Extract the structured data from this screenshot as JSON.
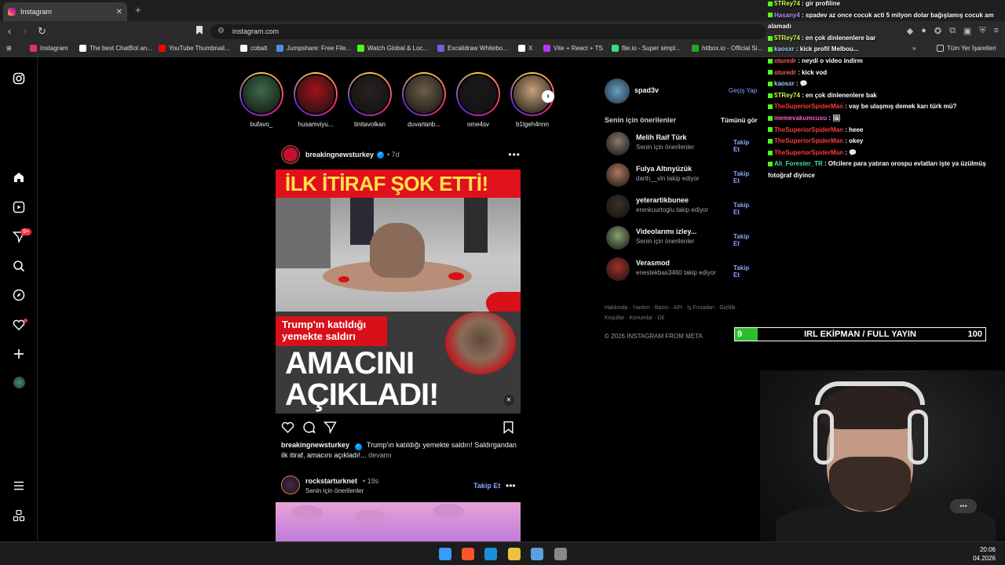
{
  "browser": {
    "tab_title": "Instagram",
    "tab_close": "✕",
    "new_tab": "+",
    "url": "instagram.com",
    "bookmarks": [
      {
        "label": "Instagram",
        "color": "#e1306c"
      },
      {
        "label": "The best ChatBot an...",
        "color": "#ffffff"
      },
      {
        "label": "YouTube Thumbnail...",
        "color": "#ff0000"
      },
      {
        "label": "cobalt",
        "color": "#ffffff"
      },
      {
        "label": "Jumpshare: Free File...",
        "color": "#4a90e2"
      },
      {
        "label": "Watch Global & Loc...",
        "color": "#53fc18"
      },
      {
        "label": "Excalidraw Whitebo...",
        "color": "#6965db"
      },
      {
        "label": "X",
        "color": "#ffffff"
      },
      {
        "label": "Vite + React + TS",
        "color": "#bd34fe"
      },
      {
        "label": "file.io - Super simpl...",
        "color": "#3ddc84"
      },
      {
        "label": "hitbox.io - Official Si...",
        "color": "#22aa22"
      }
    ],
    "all_bookmarks": "Tüm Yer İşaretleri"
  },
  "stories": [
    {
      "name": "bufavo_",
      "color": "#3d6b4a"
    },
    {
      "name": "husamviyu...",
      "color": "#a3121b"
    },
    {
      "name": "tinitavolkan",
      "color": "#2a2020"
    },
    {
      "name": "duvarlanb...",
      "color": "#6b5e4a"
    },
    {
      "name": "ome4sv",
      "color": "#1a1a1a"
    },
    {
      "name": "b1lgeh4nnn",
      "color": "#c9a27a"
    }
  ],
  "post": {
    "username": "breakingnewsturkey",
    "verified": "✓",
    "time": "• 7d",
    "more": "•••",
    "headline_top": "İLK İTİRAF ŞOK ETTİ!",
    "sub_headline": "Trump'ın katıldığı yemekte saldırı",
    "big_line1": "AMACINI",
    "big_line2": "AÇIKLADI!",
    "caption_user": "breakingnewsturkey",
    "caption_text": "Trump'ın katıldığı yemekte saldırı! Saldırgandan ilk itiraf, amacını açıkladı!...",
    "caption_more": "devamı"
  },
  "post2": {
    "username": "rockstarturknet",
    "time": "• 19s",
    "subtitle": "Senin için önerilenler",
    "follow": "Takip Et",
    "more": "•••"
  },
  "sidebar": {
    "me": "spad3v",
    "switch": "Geçiş Yap",
    "suggestions_title": "Senin için önerilenler",
    "see_all": "Tümünü gör",
    "follow_label": "Takip Et",
    "suggestions": [
      {
        "name": "Melih Raif Türk",
        "sub": "Senin için önerilenler",
        "color": "#8a7a6a"
      },
      {
        "name": "Fulya Altınyüzük",
        "sub": "darth__vin takip ediyor",
        "color": "#b07a60"
      },
      {
        "name": "yeterartikbunee",
        "sub": "erenkuurtoglu takip ediyor",
        "color": "#3a3028"
      },
      {
        "name": "Videolarımı izley...",
        "sub": "Senin için önerilenler",
        "color": "#8aa070"
      },
      {
        "name": "Verasmod",
        "sub": "enestekbas3460 takip ediyor",
        "color": "#a0302a"
      }
    ],
    "footer": "Hakkında · Yardım · Basın · API · İş Fırsatları · Gizlilik · Koşullar · Konumlar · Dil",
    "copyright": "© 2026 INSTAGRAM FROM META"
  },
  "chat": [
    {
      "user": "5TRey74",
      "color": "#c8ff4a",
      "text": "gir profiline"
    },
    {
      "user": "Hasany4",
      "color": "#b48cff",
      "text": "spadev az once cocuk acti 5 milyon dolar bağışlamış cocuk am"
    },
    {
      "user": "",
      "color": "#ffffff",
      "text": "alamadı"
    },
    {
      "user": "5TRey74",
      "color": "#c8ff4a",
      "text": "en çok dinlenenlere bar"
    },
    {
      "user": "kaosxr",
      "color": "#9ad0ff",
      "text": "kick profil Melbou..."
    },
    {
      "user": "oturedr",
      "color": "#ff5a5a",
      "text": "neydi o video indirm"
    },
    {
      "user": "oturedr",
      "color": "#ff5a5a",
      "text": "kick vod"
    },
    {
      "user": "kaosxr",
      "color": "#9ad0ff",
      "text": "💬"
    },
    {
      "user": "5TRey74",
      "color": "#c8ff4a",
      "text": "en çok dinlenenlere bak"
    },
    {
      "user": "TheSuperiorSpiderMan",
      "color": "#ff3b3b",
      "text": "vay be ulaşmış demek karı türk mü?"
    },
    {
      "user": "memevakumcusu",
      "color": "#ff5ac8",
      "text": "🖼"
    },
    {
      "user": "TheSuperiorSpiderMan",
      "color": "#ff3b3b",
      "text": "heee"
    },
    {
      "user": "TheSuperiorSpiderMan",
      "color": "#ff3b3b",
      "text": "okey"
    },
    {
      "user": "TheSuperiorSpiderMan",
      "color": "#ff3b3b",
      "text": "💬"
    },
    {
      "user": "Ali_Forester_TR",
      "color": "#4ae0a0",
      "text": "Ofcilere para yatıran orospu evlatları işte ya üzülmüş"
    },
    {
      "user": "",
      "color": "#ffffff",
      "text": "fotoğraf diyince"
    }
  ],
  "progress": {
    "current": "9",
    "target": "100",
    "fraction": 0.09,
    "title": "IRL EKİPMAN / FULL YAYIN"
  },
  "taskbar": {
    "time": "20:06",
    "date": "04.2026",
    "icons": [
      {
        "name": "windows-start-icon",
        "color": "#3a9bff"
      },
      {
        "name": "brave-browser-icon",
        "color": "#fb542b"
      },
      {
        "name": "steam-icon",
        "color": "#1b8fd8"
      },
      {
        "name": "file-explorer-icon",
        "color": "#f0c040"
      },
      {
        "name": "pc-app-icon",
        "color": "#5aa0e0"
      },
      {
        "name": "obs-icon",
        "color": "#888888"
      }
    ]
  }
}
